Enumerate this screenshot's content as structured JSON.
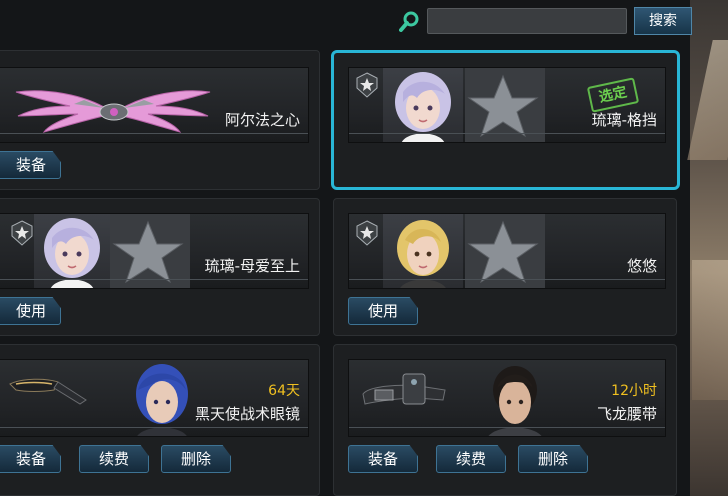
{
  "search": {
    "placeholder": "",
    "value": "",
    "button_label": "搜索"
  },
  "cards": [
    {
      "name": "阿尔法之心",
      "buttons": [
        "装备"
      ],
      "kind": "wings"
    },
    {
      "name": "琉璃-格挡",
      "stamp": "选定",
      "selected": true,
      "kind": "character"
    },
    {
      "name": "琉璃-母爱至上",
      "buttons": [
        "使用"
      ],
      "kind": "character"
    },
    {
      "name": "悠悠",
      "buttons": [
        "使用"
      ],
      "kind": "character"
    },
    {
      "name": "黑天使战术眼镜",
      "duration": "64天",
      "buttons": [
        "装备",
        "续费",
        "删除"
      ],
      "kind": "item"
    },
    {
      "name": "飞龙腰带",
      "duration": "12小时",
      "buttons": [
        "装备",
        "续费",
        "删除"
      ],
      "kind": "item"
    }
  ],
  "colors": {
    "selected_border": "#29b6d6",
    "duration_text": "#f0c020",
    "stamp_green": "#5fb84a",
    "button_blue": "#2a4b63"
  }
}
